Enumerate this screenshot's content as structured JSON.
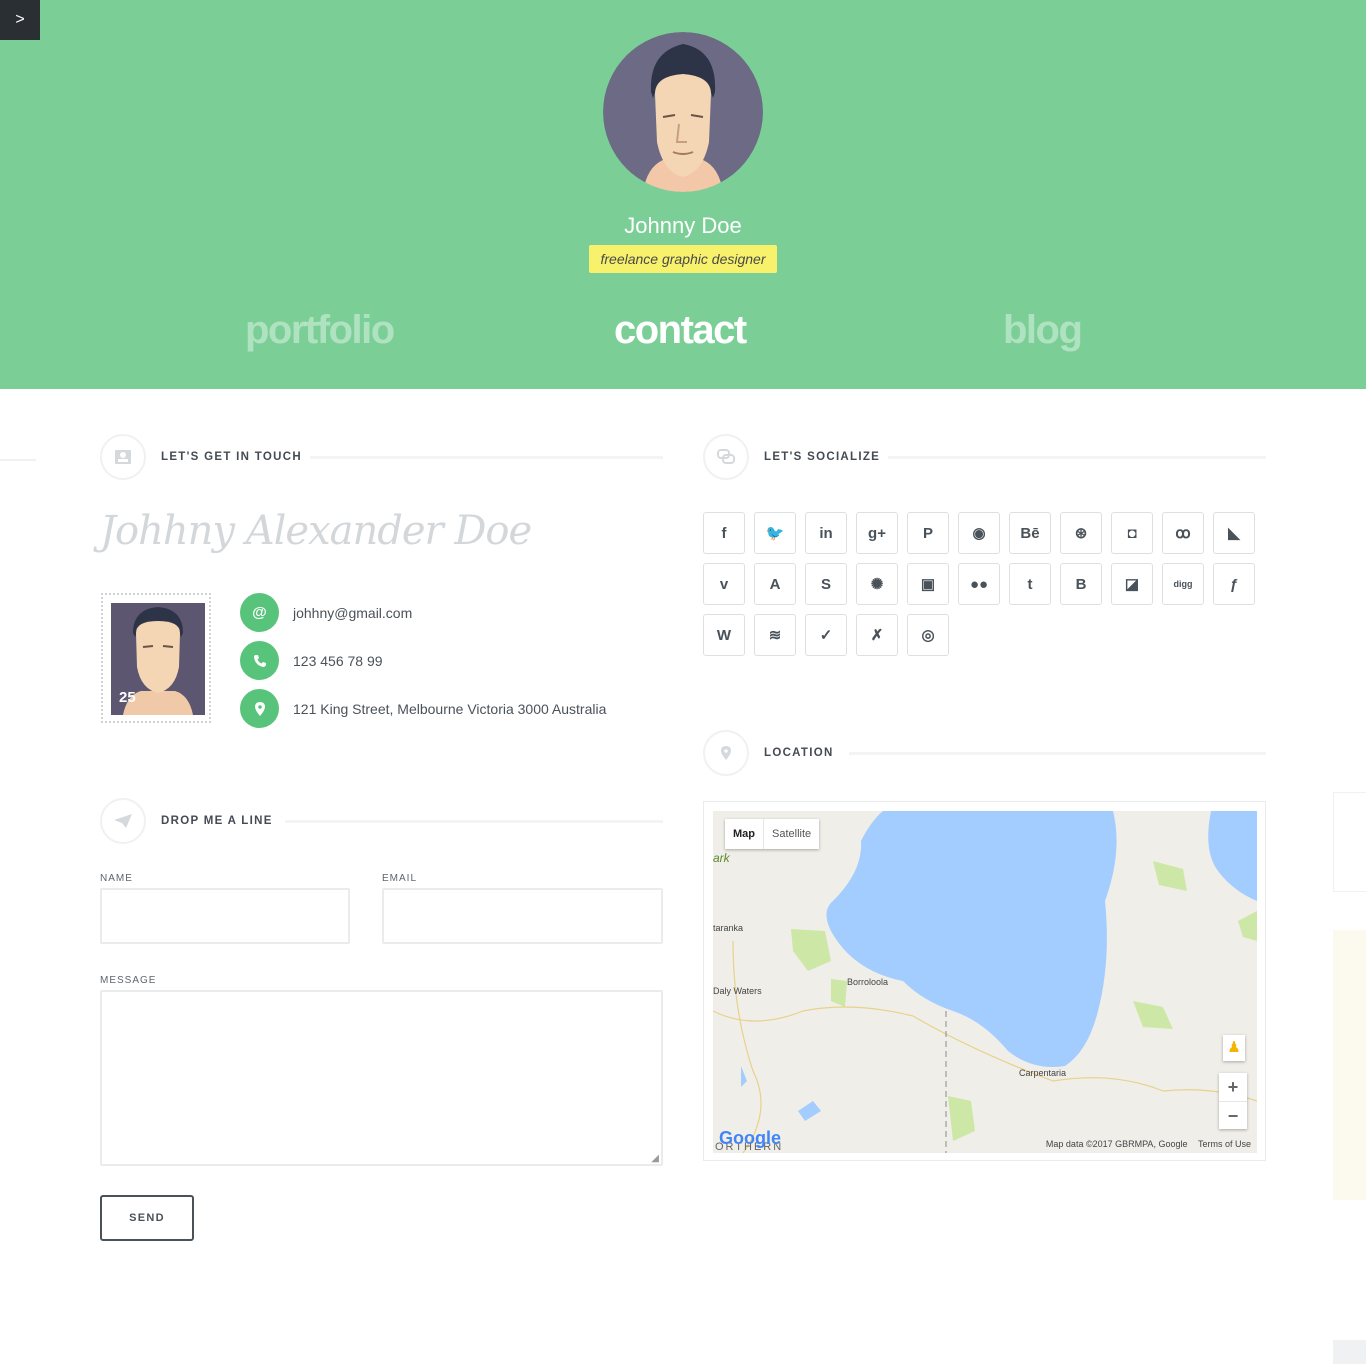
{
  "header": {
    "name": "Johnny Doe",
    "tagline": "freelance graphic designer",
    "nav": {
      "portfolio": "portfolio",
      "contact": "contact",
      "blog": "blog"
    },
    "accent": "#7bcf96",
    "tag_color": "#f7f16c"
  },
  "contact": {
    "touch_title": "LET'S GET IN TOUCH",
    "signature": "Johhny Alexander Doe",
    "stamp_value": "25",
    "email": "johhny@gmail.com",
    "phone": "123 456 78 99",
    "address": "121 King Street, Melbourne Victoria 3000 Australia",
    "email_icon": "@"
  },
  "form": {
    "title": "DROP ME A LINE",
    "name_label": "NAME",
    "email_label": "EMAIL",
    "message_label": "MESSAGE",
    "send_label": "SEND"
  },
  "social": {
    "title": "LET'S SOCIALIZE",
    "items": [
      {
        "icon": "facebook-icon",
        "glyph": "f"
      },
      {
        "icon": "twitter-icon",
        "glyph": "🐦"
      },
      {
        "icon": "linkedin-icon",
        "glyph": "in"
      },
      {
        "icon": "google-plus-icon",
        "glyph": "g+"
      },
      {
        "icon": "pinterest-icon",
        "glyph": "P"
      },
      {
        "icon": "github-icon",
        "glyph": "◉"
      },
      {
        "icon": "behance-icon",
        "glyph": "Bē"
      },
      {
        "icon": "dribbble-icon",
        "glyph": "⊛"
      },
      {
        "icon": "instagram-icon",
        "glyph": "◘"
      },
      {
        "icon": "lastfm-icon",
        "glyph": "ꝏ"
      },
      {
        "icon": "rss-icon",
        "glyph": "◣"
      },
      {
        "icon": "vimeo-icon",
        "glyph": "v"
      },
      {
        "icon": "app-net-icon",
        "glyph": "A"
      },
      {
        "icon": "skype-icon",
        "glyph": "S"
      },
      {
        "icon": "picasa-icon",
        "glyph": "✺"
      },
      {
        "icon": "youtube-icon",
        "glyph": "▣"
      },
      {
        "icon": "flickr-icon",
        "glyph": "●●"
      },
      {
        "icon": "tumblr-icon",
        "glyph": "t"
      },
      {
        "icon": "blogger-icon",
        "glyph": "B"
      },
      {
        "icon": "delicious-icon",
        "glyph": "◪"
      },
      {
        "icon": "digg-icon",
        "glyph": "digg"
      },
      {
        "icon": "foursquare-icon",
        "glyph": "ƒ"
      },
      {
        "icon": "wordpress-icon",
        "glyph": "W"
      },
      {
        "icon": "stumbleupon-icon",
        "glyph": "≋"
      },
      {
        "icon": "deviantart-icon",
        "glyph": "✓"
      },
      {
        "icon": "xing-icon",
        "glyph": "✗"
      },
      {
        "icon": "weibo-icon",
        "glyph": "◎"
      }
    ]
  },
  "location": {
    "title": "LOCATION",
    "map_tab": "Map",
    "satellite_tab": "Satellite",
    "attribution": "Map data ©2017 GBRMPA, Google",
    "terms": "Terms of Use",
    "zoom_in": "+",
    "zoom_out": "−",
    "google": "Google",
    "places": [
      {
        "label": "ark"
      },
      {
        "label": "taranka"
      },
      {
        "label": "Daly Waters"
      },
      {
        "label": "Borroloola"
      },
      {
        "label": "Carpentaria"
      },
      {
        "label": "ORTHERN"
      }
    ],
    "water_color": "#a3ccff",
    "park_color": "#cde8a6"
  }
}
